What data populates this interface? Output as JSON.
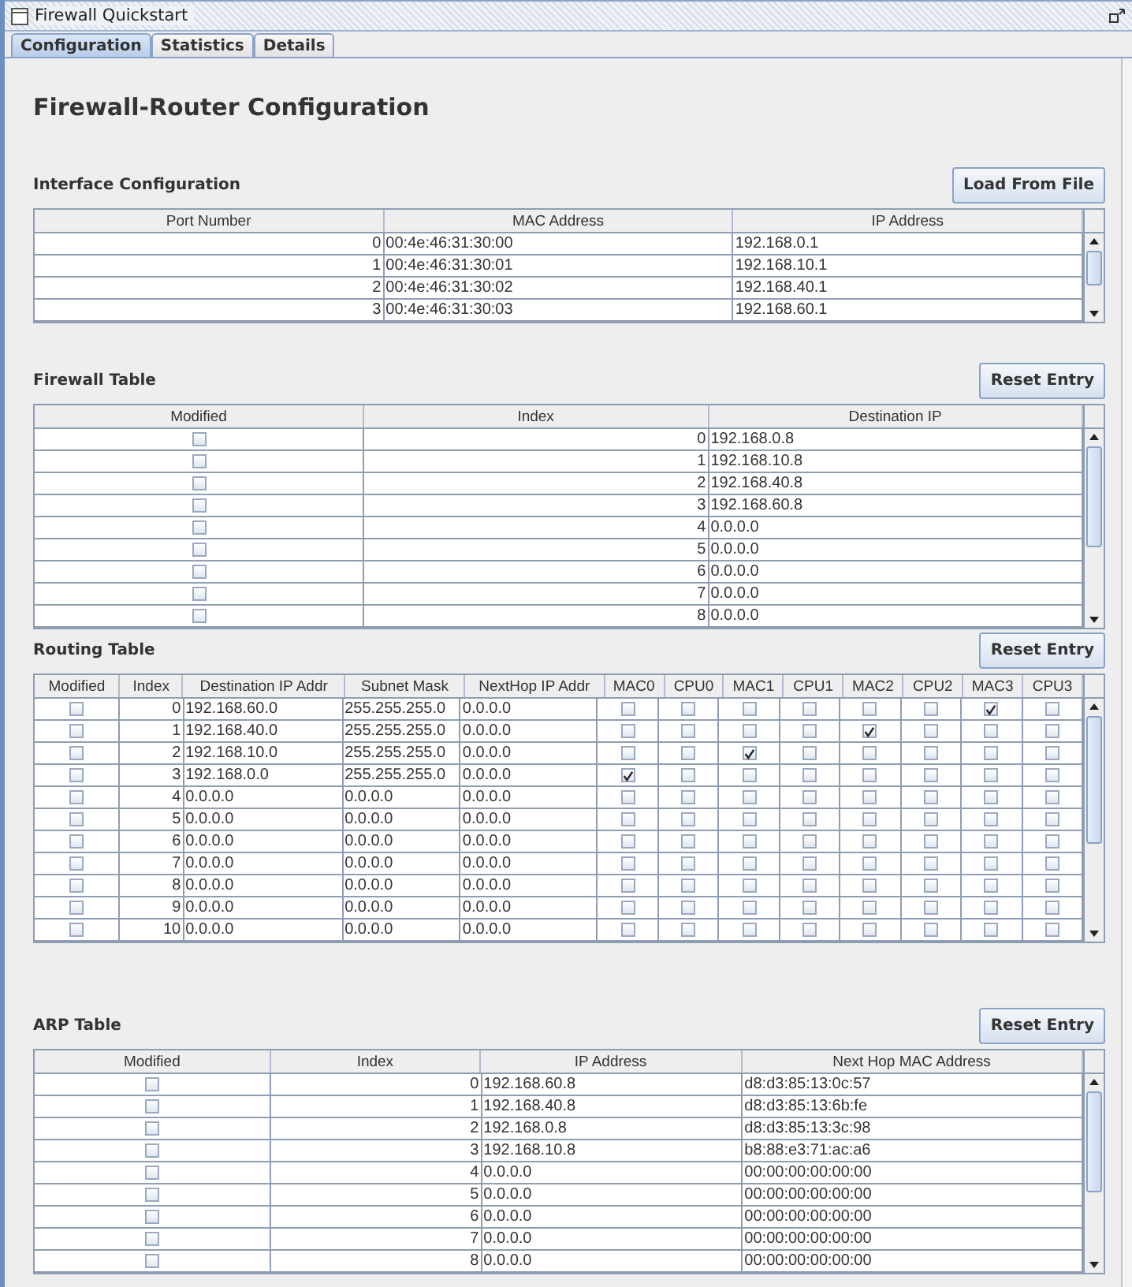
{
  "window": {
    "title": "Firewall Quickstart"
  },
  "tabs": [
    {
      "label": "Configuration",
      "selected": true
    },
    {
      "label": "Statistics",
      "selected": false
    },
    {
      "label": "Details",
      "selected": false
    }
  ],
  "heading": "Firewall-Router Configuration",
  "sections": [
    {
      "title": "Interface Configuration",
      "button": "Load From File",
      "columns": [
        {
          "label": "Port Number",
          "kind": "number"
        },
        {
          "label": "MAC Address",
          "kind": "text"
        },
        {
          "label": "IP Address",
          "kind": "text"
        }
      ],
      "rows": [
        [
          "0",
          "00:4e:46:31:30:00",
          "192.168.0.1"
        ],
        [
          "1",
          "00:4e:46:31:30:01",
          "192.168.10.1"
        ],
        [
          "2",
          "00:4e:46:31:30:02",
          "192.168.40.1"
        ],
        [
          "3",
          "00:4e:46:31:30:03",
          "192.168.60.1"
        ]
      ]
    },
    {
      "title": "Firewall Table",
      "button": "Reset Entry",
      "columns": [
        {
          "label": "Modified",
          "kind": "check"
        },
        {
          "label": "Index",
          "kind": "number"
        },
        {
          "label": "Destination IP",
          "kind": "text"
        }
      ],
      "rows": [
        [
          false,
          "0",
          "192.168.0.8"
        ],
        [
          false,
          "1",
          "192.168.10.8"
        ],
        [
          false,
          "2",
          "192.168.40.8"
        ],
        [
          false,
          "3",
          "192.168.60.8"
        ],
        [
          false,
          "4",
          "0.0.0.0"
        ],
        [
          false,
          "5",
          "0.0.0.0"
        ],
        [
          false,
          "6",
          "0.0.0.0"
        ],
        [
          false,
          "7",
          "0.0.0.0"
        ],
        [
          false,
          "8",
          "0.0.0.0"
        ]
      ]
    },
    {
      "title": "Routing Table",
      "button": "Reset Entry",
      "columns": [
        {
          "label": "Modified",
          "kind": "check"
        },
        {
          "label": "Index",
          "kind": "number"
        },
        {
          "label": "Destination IP Addr",
          "kind": "text"
        },
        {
          "label": "Subnet Mask",
          "kind": "text"
        },
        {
          "label": "NextHop IP Addr",
          "kind": "text"
        },
        {
          "label": "MAC0",
          "kind": "check"
        },
        {
          "label": "CPU0",
          "kind": "check"
        },
        {
          "label": "MAC1",
          "kind": "check"
        },
        {
          "label": "CPU1",
          "kind": "check"
        },
        {
          "label": "MAC2",
          "kind": "check"
        },
        {
          "label": "CPU2",
          "kind": "check"
        },
        {
          "label": "MAC3",
          "kind": "check"
        },
        {
          "label": "CPU3",
          "kind": "check"
        }
      ],
      "rows": [
        [
          false,
          "0",
          "192.168.60.0",
          "255.255.255.0",
          "0.0.0.0",
          false,
          false,
          false,
          false,
          false,
          false,
          true,
          false
        ],
        [
          false,
          "1",
          "192.168.40.0",
          "255.255.255.0",
          "0.0.0.0",
          false,
          false,
          false,
          false,
          true,
          false,
          false,
          false
        ],
        [
          false,
          "2",
          "192.168.10.0",
          "255.255.255.0",
          "0.0.0.0",
          false,
          false,
          true,
          false,
          false,
          false,
          false,
          false
        ],
        [
          false,
          "3",
          "192.168.0.0",
          "255.255.255.0",
          "0.0.0.0",
          true,
          false,
          false,
          false,
          false,
          false,
          false,
          false
        ],
        [
          false,
          "4",
          "0.0.0.0",
          "0.0.0.0",
          "0.0.0.0",
          false,
          false,
          false,
          false,
          false,
          false,
          false,
          false
        ],
        [
          false,
          "5",
          "0.0.0.0",
          "0.0.0.0",
          "0.0.0.0",
          false,
          false,
          false,
          false,
          false,
          false,
          false,
          false
        ],
        [
          false,
          "6",
          "0.0.0.0",
          "0.0.0.0",
          "0.0.0.0",
          false,
          false,
          false,
          false,
          false,
          false,
          false,
          false
        ],
        [
          false,
          "7",
          "0.0.0.0",
          "0.0.0.0",
          "0.0.0.0",
          false,
          false,
          false,
          false,
          false,
          false,
          false,
          false
        ],
        [
          false,
          "8",
          "0.0.0.0",
          "0.0.0.0",
          "0.0.0.0",
          false,
          false,
          false,
          false,
          false,
          false,
          false,
          false
        ],
        [
          false,
          "9",
          "0.0.0.0",
          "0.0.0.0",
          "0.0.0.0",
          false,
          false,
          false,
          false,
          false,
          false,
          false,
          false
        ],
        [
          false,
          "10",
          "0.0.0.0",
          "0.0.0.0",
          "0.0.0.0",
          false,
          false,
          false,
          false,
          false,
          false,
          false,
          false
        ]
      ]
    },
    {
      "title": "ARP Table",
      "button": "Reset Entry",
      "columns": [
        {
          "label": "Modified",
          "kind": "check"
        },
        {
          "label": "Index",
          "kind": "number"
        },
        {
          "label": "IP Address",
          "kind": "text"
        },
        {
          "label": "Next Hop MAC Address",
          "kind": "text"
        }
      ],
      "rows": [
        [
          false,
          "0",
          "192.168.60.8",
          "d8:d3:85:13:0c:57"
        ],
        [
          false,
          "1",
          "192.168.40.8",
          "d8:d3:85:13:6b:fe"
        ],
        [
          false,
          "2",
          "192.168.0.8",
          "d8:d3:85:13:3c:98"
        ],
        [
          false,
          "3",
          "192.168.10.8",
          "b8:88:e3:71:ac:a6"
        ],
        [
          false,
          "4",
          "0.0.0.0",
          "00:00:00:00:00:00"
        ],
        [
          false,
          "5",
          "0.0.0.0",
          "00:00:00:00:00:00"
        ],
        [
          false,
          "6",
          "0.0.0.0",
          "00:00:00:00:00:00"
        ],
        [
          false,
          "7",
          "0.0.0.0",
          "00:00:00:00:00:00"
        ],
        [
          false,
          "8",
          "0.0.0.0",
          "00:00:00:00:00:00"
        ]
      ]
    }
  ]
}
